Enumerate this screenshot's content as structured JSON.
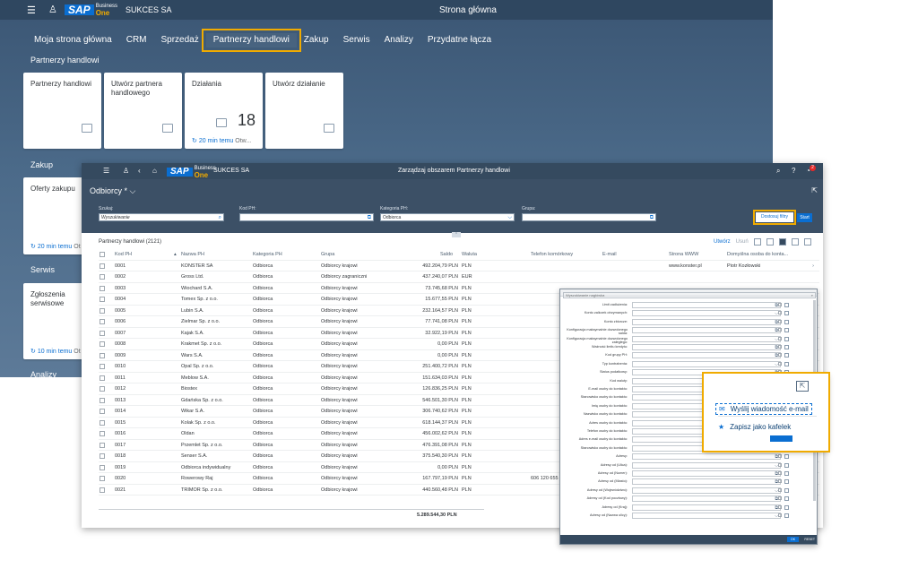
{
  "launchpad": {
    "shell": {
      "company": "SUKCES SA",
      "page_title": "Strona główna",
      "logo_sap": "SAP",
      "logo_b1_line1": "Business",
      "logo_b1_line2": "One"
    },
    "tabs": [
      {
        "label": "Moja strona główna",
        "active": false
      },
      {
        "label": "CRM",
        "active": false
      },
      {
        "label": "Sprzedaż",
        "active": false
      },
      {
        "label": "Partnerzy handlowi",
        "active": true
      },
      {
        "label": "Zakup",
        "active": false
      },
      {
        "label": "Serwis",
        "active": false
      },
      {
        "label": "Analizy",
        "active": false
      },
      {
        "label": "Przydatne łącza",
        "active": false
      }
    ],
    "sections": {
      "partners": "Partnerzy handlowi",
      "purchase": "Zakup",
      "service": "Serwis",
      "analytics": "Analizy"
    },
    "tiles": {
      "partners": {
        "title": "Partnerzy handlowi"
      },
      "create_partner": {
        "title": "Utwórz partnera handlowego"
      },
      "activities": {
        "title": "Działania",
        "count": "18",
        "refresh": "20 min temu",
        "suffix": "Otw..."
      },
      "create_activity": {
        "title": "Utwórz działanie"
      },
      "purchase_offers": {
        "title": "Oferty zakupu",
        "refresh": "20 min temu",
        "suffix": "Ot"
      },
      "service_calls": {
        "title": "Zgłoszenia serwisowe",
        "refresh": "10 min temu",
        "suffix": "Ot"
      }
    }
  },
  "window": {
    "shell": {
      "company": "SUKCES SA",
      "title": "Zarządzaj obszarem Partnerzy handlowi",
      "logo_sap": "SAP",
      "logo_b1_line1": "Business",
      "logo_b1_line2": "One",
      "badge": "2"
    },
    "variant": "Odbiorcy *",
    "filters": {
      "search": {
        "label": "Szukaj:",
        "value": "Wyszukiwanie"
      },
      "code": {
        "label": "Kod PH:",
        "value": ""
      },
      "category": {
        "label": "Kategoria PH:",
        "value": "Odbiorca"
      },
      "group": {
        "label": "Grupa:",
        "value": ""
      }
    },
    "buttons": {
      "adapt": "Dostosuj filtry",
      "go": "Start"
    },
    "table": {
      "title": "Partnerzy handlowi (2121)",
      "tools": {
        "create": "Utwórz",
        "delete": "Usuń"
      },
      "columns": [
        "Kod PH",
        "Nazwa PH",
        "Kategoria PH",
        "Grupa",
        "Saldo",
        "Waluta",
        "Telefon komórkowy",
        "E-mail",
        "Strona WWW",
        "Domyślna osoba do konta..."
      ],
      "rows": [
        {
          "code": "0001",
          "name": "KONSTER SA",
          "cat": "Odbiorca",
          "group": "Odbiorcy krajowi",
          "saldo": "492.204,79 PLN",
          "cur": "PLN",
          "phone": "",
          "email": "",
          "www": "www.konster.pl",
          "contact": "Piotr Kozłowski"
        },
        {
          "code": "0002",
          "name": "Gross Ltd.",
          "cat": "Odbiorca",
          "group": "Odbiorcy zagraniczni",
          "saldo": "437.240,07 PLN",
          "cur": "EUR",
          "phone": "",
          "email": "",
          "www": "",
          "contact": ""
        },
        {
          "code": "0003",
          "name": "Wiochard S.A.",
          "cat": "Odbiorca",
          "group": "Odbiorcy krajowi",
          "saldo": "73.745,68 PLN",
          "cur": "PLN",
          "phone": "",
          "email": "",
          "www": "",
          "contact": ""
        },
        {
          "code": "0004",
          "name": "Tomex Sp. z o.o.",
          "cat": "Odbiorca",
          "group": "Odbiorcy krajowi",
          "saldo": "15.677,55 PLN",
          "cur": "PLN",
          "phone": "",
          "email": "",
          "www": "",
          "contact": ""
        },
        {
          "code": "0005",
          "name": "Lubin S.A.",
          "cat": "Odbiorca",
          "group": "Odbiorcy krajowi",
          "saldo": "232.164,57 PLN",
          "cur": "PLN",
          "phone": "",
          "email": "",
          "www": "",
          "contact": ""
        },
        {
          "code": "0006",
          "name": "Zielmar Sp. z o.o.",
          "cat": "Odbiorca",
          "group": "Odbiorcy krajowi",
          "saldo": "77.741,08 PLN",
          "cur": "PLN",
          "phone": "",
          "email": "",
          "www": "",
          "contact": ""
        },
        {
          "code": "0007",
          "name": "Kajak S.A.",
          "cat": "Odbiorca",
          "group": "Odbiorcy krajowi",
          "saldo": "32.922,19 PLN",
          "cur": "PLN",
          "phone": "",
          "email": "",
          "www": "",
          "contact": ""
        },
        {
          "code": "0008",
          "name": "Krakmet Sp. z o.o.",
          "cat": "Odbiorca",
          "group": "Odbiorcy krajowi",
          "saldo": "0,00 PLN",
          "cur": "PLN",
          "phone": "",
          "email": "",
          "www": "",
          "contact": ""
        },
        {
          "code": "0009",
          "name": "Wars S.A.",
          "cat": "Odbiorca",
          "group": "Odbiorcy krajowi",
          "saldo": "0,00 PLN",
          "cur": "PLN",
          "phone": "",
          "email": "",
          "www": "",
          "contact": ""
        },
        {
          "code": "0010",
          "name": "Opal Sp. z o.o.",
          "cat": "Odbiorca",
          "group": "Odbiorcy krajowi",
          "saldo": "251.400,72 PLN",
          "cur": "PLN",
          "phone": "",
          "email": "",
          "www": "",
          "contact": ""
        },
        {
          "code": "0011",
          "name": "Meblow S.A.",
          "cat": "Odbiorca",
          "group": "Odbiorcy krajowi",
          "saldo": "151.634,03 PLN",
          "cur": "PLN",
          "phone": "",
          "email": "",
          "www": "",
          "contact": ""
        },
        {
          "code": "0012",
          "name": "Biostex",
          "cat": "Odbiorca",
          "group": "Odbiorcy krajowi",
          "saldo": "126.836,25 PLN",
          "cur": "PLN",
          "phone": "",
          "email": "",
          "www": "",
          "contact": ""
        },
        {
          "code": "0013",
          "name": "Gdańska Sp. z o.o.",
          "cat": "Odbiorca",
          "group": "Odbiorcy krajowi",
          "saldo": "546.501,30 PLN",
          "cur": "PLN",
          "phone": "",
          "email": "",
          "www": "",
          "contact": ""
        },
        {
          "code": "0014",
          "name": "Wikar S.A.",
          "cat": "Odbiorca",
          "group": "Odbiorcy krajowi",
          "saldo": "306.740,62 PLN",
          "cur": "PLN",
          "phone": "",
          "email": "",
          "www": "",
          "contact": ""
        },
        {
          "code": "0015",
          "name": "Kolak Sp. z o.o.",
          "cat": "Odbiorca",
          "group": "Odbiorcy krajowi",
          "saldo": "618.144,37 PLN",
          "cur": "PLN",
          "phone": "",
          "email": "",
          "www": "",
          "contact": ""
        },
        {
          "code": "0016",
          "name": "Oldan",
          "cat": "Odbiorca",
          "group": "Odbiorcy krajowi",
          "saldo": "456.002,62 PLN",
          "cur": "PLN",
          "phone": "",
          "email": "",
          "www": "",
          "contact": ""
        },
        {
          "code": "0017",
          "name": "Przemlet Sp. z o.o.",
          "cat": "Odbiorca",
          "group": "Odbiorcy krajowi",
          "saldo": "476.391,08 PLN",
          "cur": "PLN",
          "phone": "",
          "email": "",
          "www": "",
          "contact": ""
        },
        {
          "code": "0018",
          "name": "Senser S.A.",
          "cat": "Odbiorca",
          "group": "Odbiorcy krajowi",
          "saldo": "375.540,30 PLN",
          "cur": "PLN",
          "phone": "",
          "email": "",
          "www": "",
          "contact": ""
        },
        {
          "code": "0019",
          "name": "Odbiorca indywidualny",
          "cat": "Odbiorca",
          "group": "Odbiorcy krajowi",
          "saldo": "0,00 PLN",
          "cur": "PLN",
          "phone": "",
          "email": "",
          "www": "",
          "contact": ""
        },
        {
          "code": "0020",
          "name": "Rowerowy Raj",
          "cat": "Odbiorca",
          "group": "Odbiorcy krajowi",
          "saldo": "167.797,19 PLN",
          "cur": "PLN",
          "phone": "606 120 655",
          "email": "",
          "www": "",
          "contact": ""
        },
        {
          "code": "0021",
          "name": "TRIMOR Sp. z o.o.",
          "cat": "Odbiorca",
          "group": "Odbiorcy krajowi",
          "saldo": "440.560,48 PLN",
          "cur": "PLN",
          "phone": "",
          "email": "",
          "www": "",
          "contact": ""
        }
      ],
      "total": "5.289.544,30 PLN"
    }
  },
  "column_settings": {
    "search_placeholder": "Wyszukiwanie nagłówka",
    "rows": [
      "Limit zadłużenia:",
      "Konto zaliczek otrzymanych:",
      "Konto zbiorcze:",
      "Konfiguracja maksymalnie dozwolonego salda:",
      "Konfiguracja maksymalnie dozwolonego zaległego:",
      "Ważność limitu kredytu:",
      "Kod grupy PH:",
      "Typ kontrahenta:",
      "Status podatkowy:",
      "Kod waluty:",
      "E-mail osoby do kontaktu:",
      "Stanowisko osoby do kontaktu:",
      "Imię osoby do kontaktu:",
      "Nazwisko osoby do kontaktu:",
      "Adres osoby do kontaktu:",
      "Telefon osoby do kontaktu:",
      "Adres e-mail osoby do kontaktu:",
      "Stanowisko osoby do kontaktu:",
      "Adresy:",
      "Adresy od (Ulica):",
      "Adresy od (Numer):",
      "Adresy od (Miasto):",
      "Adresy od (Województwo):",
      "Adresy od (Kod pocztowy):",
      "Adresy od (Kraj):",
      "Adresy od (Nazwa ulicy):"
    ],
    "ok": "OK",
    "reset": "RESET"
  },
  "share_menu": {
    "email": "Wyślij wiadomość e-mail",
    "tile": "Zapisz jako kafelek"
  },
  "colors": {
    "accent": "#0a6ed1",
    "highlight": "#f0ab00",
    "shell": "#354a5f"
  }
}
